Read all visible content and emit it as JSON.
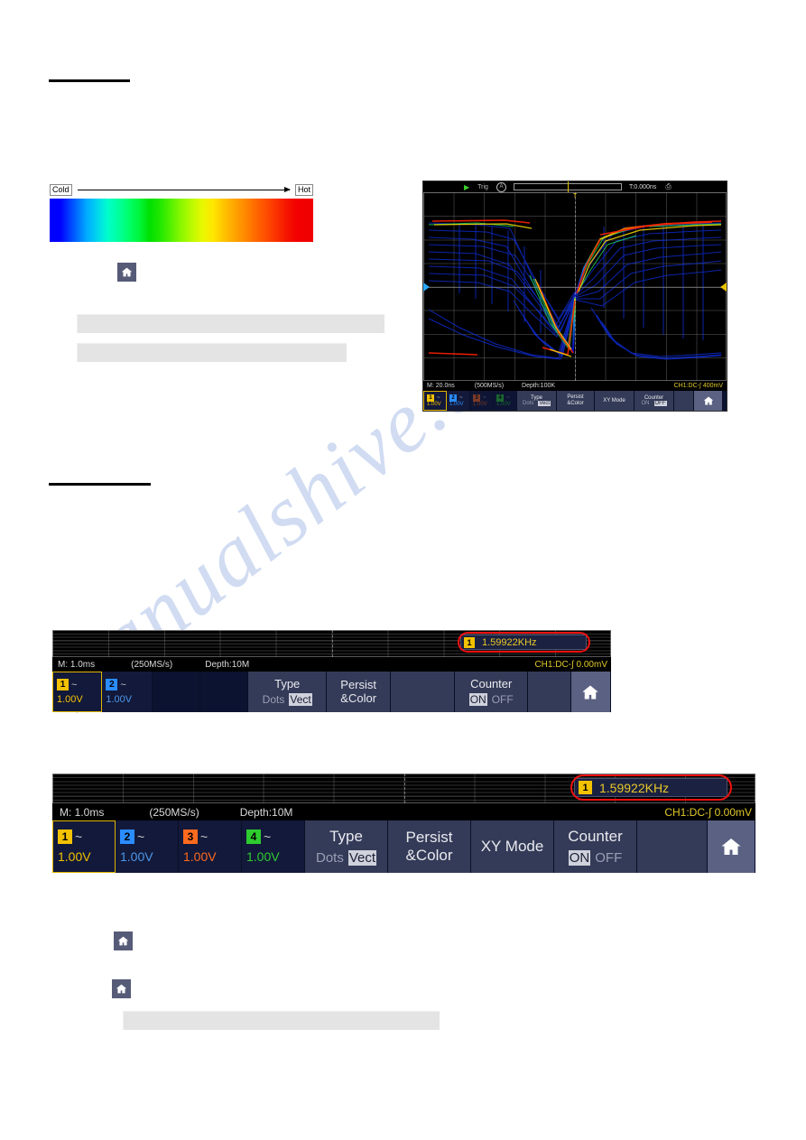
{
  "page": {
    "watermark": "manualshive.com"
  },
  "persist_color_section": {
    "legend": {
      "cold_label": "Cold",
      "hot_label": "Hot",
      "gradient_colors": [
        "#0000ff",
        "#00d4ee",
        "#00e000",
        "#ffe600",
        "#ff8a00",
        "#f00000"
      ]
    },
    "home_icon": "home-icon"
  },
  "scope_persist": {
    "topbar": {
      "play_glyph": "▶",
      "trig_label": "Trig",
      "acq_mode": "A",
      "time_readout": "T:0.000ns",
      "lock_glyph": "⎙"
    },
    "trig_marker": "T",
    "info": {
      "timebase": "M: 20.0ns",
      "samplerate": "(500MS/s)",
      "depth": "Depth:100K",
      "trigger": "CH1:DC-∫ 400mV"
    },
    "menu": {
      "channels": [
        {
          "num": "1",
          "tilde": "~",
          "scale": "1.00V",
          "color": "#f2c200",
          "active": true
        },
        {
          "num": "2",
          "tilde": "~",
          "scale": "1.00V",
          "color": "#2a8cff",
          "active": false
        },
        {
          "num": "3",
          "tilde": "~",
          "scale": "1.00V",
          "color": "#ff6a1e",
          "active": false
        },
        {
          "num": "4",
          "tilde": "~",
          "scale": "1.00V",
          "color": "#2ecc2e",
          "active": false
        }
      ],
      "type": {
        "title": "Type",
        "options": [
          "Dots",
          "Vect"
        ],
        "selected": "Vect"
      },
      "persist": {
        "line1": "Persist",
        "line2": "&Color"
      },
      "xy_mode": "XY Mode",
      "counter": {
        "title": "Counter",
        "options": [
          "ON",
          "OFF"
        ],
        "selected": "OFF"
      },
      "home": "home-icon"
    }
  },
  "scope_counter_2ch": {
    "freq_readout": {
      "channel": "1",
      "value": "1.59922KHz"
    },
    "info": {
      "timebase": "M: 1.0ms",
      "samplerate": "(250MS/s)",
      "depth": "Depth:10M",
      "trigger": "CH1:DC-∫ 0.00mV"
    },
    "menu": {
      "channels": [
        {
          "num": "1",
          "tilde": "~",
          "scale": "1.00V",
          "color": "#f2c200",
          "active": true
        },
        {
          "num": "2",
          "tilde": "~",
          "scale": "1.00V",
          "color": "#2a8cff",
          "active": false
        }
      ],
      "type": {
        "title": "Type",
        "options": [
          "Dots",
          "Vect"
        ],
        "selected": "Vect"
      },
      "persist": {
        "line1": "Persist",
        "line2": "&Color"
      },
      "xy_mode": "",
      "counter": {
        "title": "Counter",
        "options": [
          "ON",
          "OFF"
        ],
        "selected": "ON"
      },
      "home": "home-icon"
    }
  },
  "scope_counter_4ch": {
    "freq_readout": {
      "channel": "1",
      "value": "1.59922KHz"
    },
    "info": {
      "timebase": "M: 1.0ms",
      "samplerate": "(250MS/s)",
      "depth": "Depth:10M",
      "trigger": "CH1:DC-∫ 0.00mV"
    },
    "menu": {
      "channels": [
        {
          "num": "1",
          "tilde": "~",
          "scale": "1.00V",
          "color": "#f2c200",
          "active": true
        },
        {
          "num": "2",
          "tilde": "~",
          "scale": "1.00V",
          "color": "#2a8cff",
          "active": false
        },
        {
          "num": "3",
          "tilde": "~",
          "scale": "1.00V",
          "color": "#ff6a1e",
          "active": false
        },
        {
          "num": "4",
          "tilde": "~",
          "scale": "1.00V",
          "color": "#2ecc2e",
          "active": false
        }
      ],
      "type": {
        "title": "Type",
        "options": [
          "Dots",
          "Vect"
        ],
        "selected": "Vect"
      },
      "persist": {
        "line1": "Persist",
        "line2": "&Color"
      },
      "xy_mode": "XY Mode",
      "counter": {
        "title": "Counter",
        "options": [
          "ON",
          "OFF"
        ],
        "selected": "ON"
      },
      "home": "home-icon"
    }
  }
}
